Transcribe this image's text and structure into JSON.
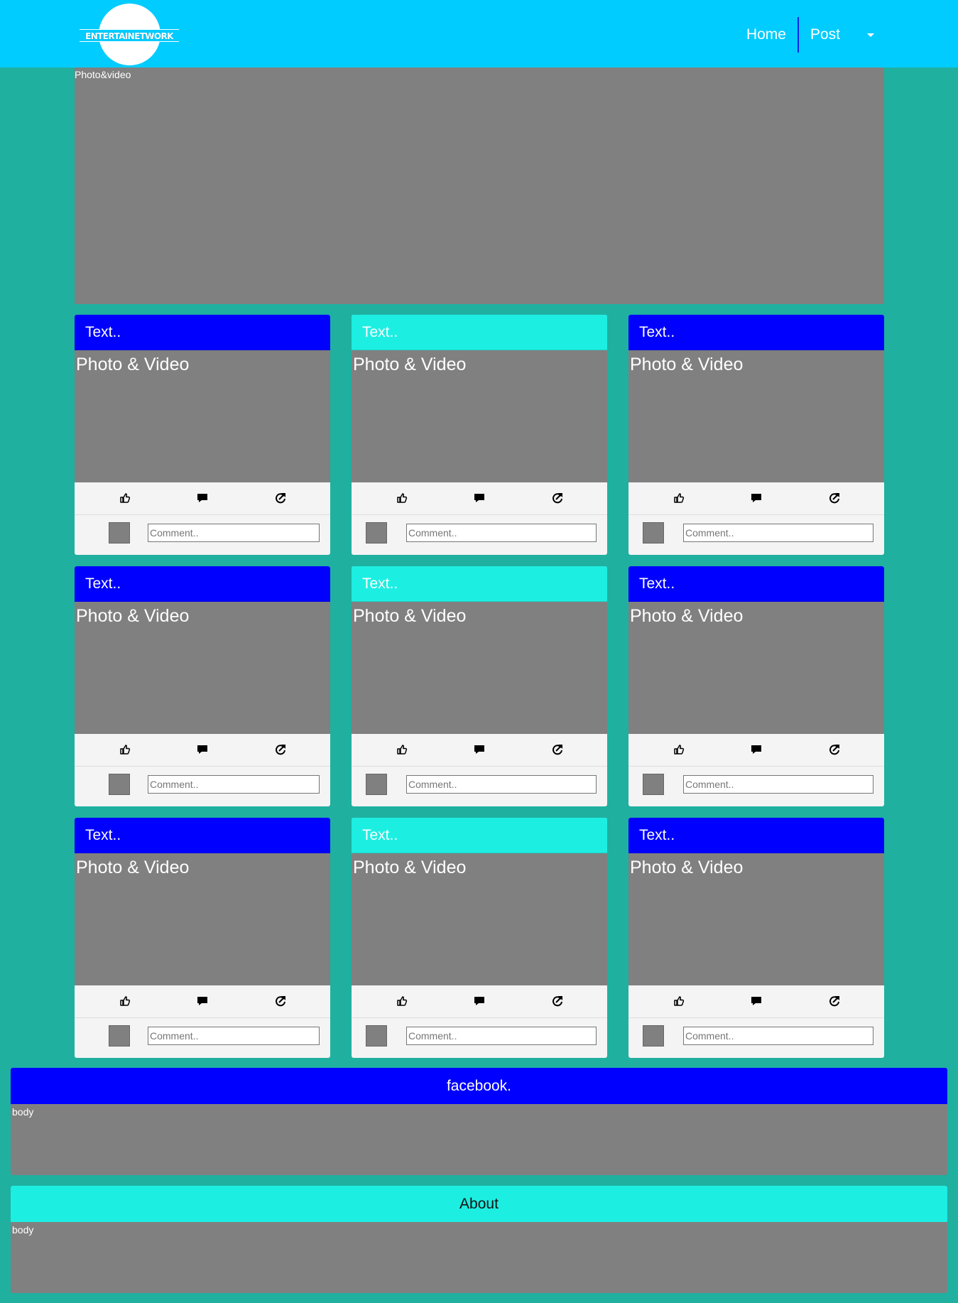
{
  "navbar": {
    "logo_text": "ENTERTAINETWORK",
    "links": [
      "Home",
      "Post"
    ],
    "background": "#00ccff"
  },
  "hero": {
    "label": "Photo&video"
  },
  "cards": [
    {
      "header": "Text..",
      "media": "Photo & Video",
      "header_color": "blue",
      "comment_placeholder": "Comment.."
    },
    {
      "header": "Text..",
      "media": "Photo & Video",
      "header_color": "cyan",
      "comment_placeholder": "Comment.."
    },
    {
      "header": "Text..",
      "media": "Photo & Video",
      "header_color": "blue",
      "comment_placeholder": "Comment.."
    },
    {
      "header": "Text..",
      "media": "Photo & Video",
      "header_color": "blue",
      "comment_placeholder": "Comment.."
    },
    {
      "header": "Text..",
      "media": "Photo & Video",
      "header_color": "cyan",
      "comment_placeholder": "Comment.."
    },
    {
      "header": "Text..",
      "media": "Photo & Video",
      "header_color": "blue",
      "comment_placeholder": "Comment.."
    },
    {
      "header": "Text..",
      "media": "Photo & Video",
      "header_color": "blue",
      "comment_placeholder": "Comment.."
    },
    {
      "header": "Text..",
      "media": "Photo & Video",
      "header_color": "cyan",
      "comment_placeholder": "Comment.."
    },
    {
      "header": "Text..",
      "media": "Photo & Video",
      "header_color": "blue",
      "comment_placeholder": "Comment.."
    }
  ],
  "card_icons": [
    "thumbs-up-icon",
    "comment-icon",
    "share-icon"
  ],
  "panels": [
    {
      "title": "facebook.",
      "body": "body",
      "color": "blue"
    },
    {
      "title": "About",
      "body": "body",
      "color": "cyan"
    }
  ],
  "colors": {
    "page_background": "#1fb0a0",
    "blue": "#0000ff",
    "cyan": "#1deee2",
    "media_gray": "#808080"
  }
}
